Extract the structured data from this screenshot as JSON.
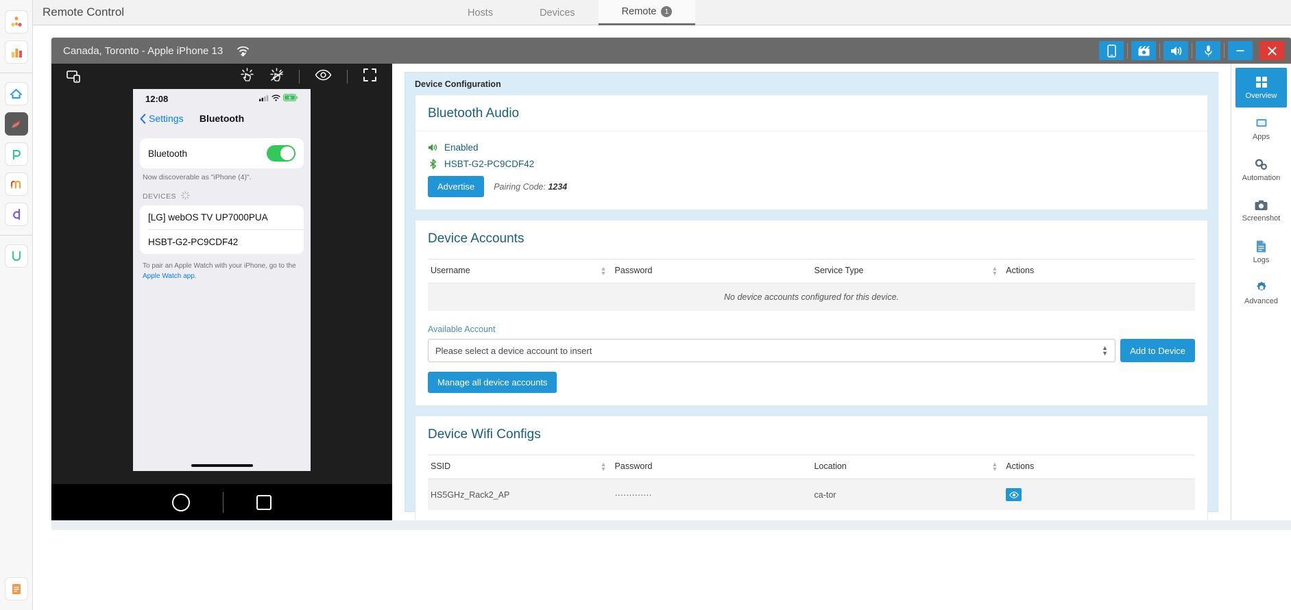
{
  "app_rail": {
    "items": [
      {
        "name": "org-chart-icon",
        "glyph": "♣"
      },
      {
        "name": "bar-chart-icon",
        "glyph": "▐"
      },
      {
        "name": "home-icon",
        "glyph": "⌂"
      },
      {
        "name": "flame-icon",
        "glyph": "г"
      },
      {
        "name": "p-app-icon",
        "glyph": "p"
      },
      {
        "name": "m-app-icon",
        "glyph": "m"
      },
      {
        "name": "d-app-icon",
        "glyph": "d"
      },
      {
        "name": "u-app-icon",
        "glyph": "U"
      },
      {
        "name": "document-icon",
        "glyph": "☰"
      }
    ]
  },
  "header": {
    "title": "Remote Control",
    "tabs": [
      {
        "label": "Hosts",
        "active": false
      },
      {
        "label": "Devices",
        "active": false
      },
      {
        "label": "Remote",
        "active": true,
        "badge": "1"
      }
    ]
  },
  "device_window": {
    "title": "Canada, Toronto - Apple iPhone 13",
    "wifi_status_icon": "wifi-check-icon",
    "controls": [
      {
        "name": "device-view-button",
        "glyph": "▯"
      },
      {
        "name": "video-record-button",
        "glyph": "🎬"
      },
      {
        "name": "speaker-button",
        "glyph": "🔊"
      },
      {
        "name": "microphone-button",
        "glyph": "🎤"
      }
    ],
    "minimize_label": "—",
    "close_label": "✕"
  },
  "phone_toolbar": {
    "left_icon": "device-frame-icon",
    "right_icons": [
      {
        "name": "tap-gesture-icon"
      },
      {
        "name": "tap-gesture-disabled-icon"
      },
      {
        "name": "eye-icon"
      },
      {
        "name": "fullscreen-icon"
      }
    ]
  },
  "phone_screen": {
    "status_time": "12:08",
    "signal_icon": "cellular-signal-icon",
    "wifi_icon": "wifi-icon",
    "battery_icon": "battery-charging-icon",
    "back_label": "Settings",
    "nav_title": "Bluetooth",
    "bluetooth_row_label": "Bluetooth",
    "bluetooth_enabled": true,
    "discoverable_note": "Now discoverable as \"iPhone (4)\".",
    "devices_header": "DEVICES",
    "devices": [
      "[LG] webOS TV UP7000PUA",
      "HSBT-G2-PC9CDF42"
    ],
    "footer_text": "To pair an Apple Watch with your iPhone, go to the ",
    "footer_link": "Apple Watch app",
    "footer_tail": "."
  },
  "phone_footer": {
    "home_button": "home-button",
    "square_button": "square-button"
  },
  "config": {
    "header": "Device Configuration",
    "bluetooth_audio": {
      "title": "Bluetooth Audio",
      "status_label": "Enabled",
      "device_name": "HSBT-G2-PC9CDF42",
      "advertise_label": "Advertise",
      "pairing_label": "Pairing Code:",
      "pairing_code": "1234"
    },
    "device_accounts": {
      "title": "Device Accounts",
      "columns": [
        "Username",
        "Password",
        "Service Type",
        "Actions"
      ],
      "empty_message": "No device accounts configured for this device.",
      "available_account_label": "Available Account",
      "select_value": "Please select a device account to insert",
      "add_button": "Add to Device",
      "manage_button": "Manage all device accounts"
    },
    "wifi_configs": {
      "title": "Device Wifi Configs",
      "columns": [
        "SSID",
        "Password",
        "Location",
        "Actions"
      ],
      "rows": [
        {
          "ssid": "HS5GHz_Rack2_AP",
          "password": "·············",
          "location": "ca-tor",
          "action_icon": "eye-icon"
        }
      ]
    }
  },
  "right_sidebar": {
    "items": [
      {
        "label": "Overview",
        "icon": "grid-icon",
        "glyph": "▦",
        "active": true
      },
      {
        "label": "Apps",
        "icon": "apps-icon",
        "glyph": "❐",
        "active": false
      },
      {
        "label": "Automation",
        "icon": "gears-icon",
        "glyph": "⚙",
        "active": false
      },
      {
        "label": "Screenshot",
        "icon": "camera-icon",
        "glyph": "▣",
        "active": false
      },
      {
        "label": "Logs",
        "icon": "log-file-icon",
        "glyph": "≡",
        "active": false
      },
      {
        "label": "Advanced",
        "icon": "settings-icon",
        "glyph": "☸",
        "active": false
      }
    ]
  },
  "colors": {
    "accent_blue": "#2196d6",
    "panel_title": "#17607f",
    "toggle_green": "#34c759",
    "close_red": "#e03a35",
    "config_bg": "#d9ecf7"
  }
}
